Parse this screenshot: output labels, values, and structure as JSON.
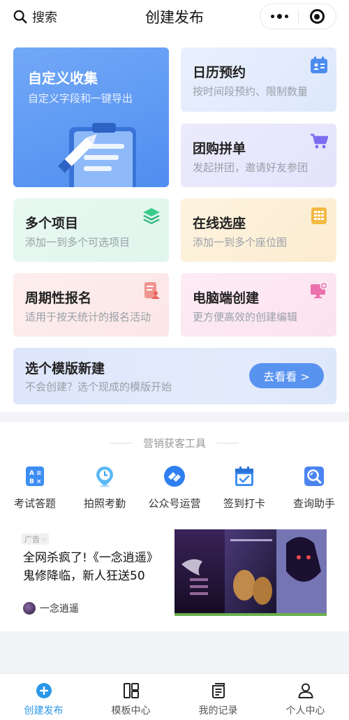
{
  "header": {
    "search_label": "搜索",
    "title": "创建发布"
  },
  "cards": {
    "custom": {
      "title": "自定义收集",
      "subtitle": "自定义字段和一键导出"
    },
    "calendar": {
      "title": "日历预约",
      "subtitle": "按时间段预约、限制数量"
    },
    "group": {
      "title": "团购拼单",
      "subtitle": "发起拼团，邀请好友参团"
    },
    "multi": {
      "title": "多个项目",
      "subtitle": "添加一到多个可选项目"
    },
    "seat": {
      "title": "在线选座",
      "subtitle": "添加一到多个座位图"
    },
    "period": {
      "title": "周期性报名",
      "subtitle": "适用于按天统计的报名活动"
    },
    "pc": {
      "title": "电脑端创建",
      "subtitle": "更方便高效的创建编辑"
    },
    "template": {
      "title": "选个模版新建",
      "subtitle": "不会创建？选个现成的模版开始",
      "button": "去看看 >"
    }
  },
  "marketing": {
    "section_title": "营销获客工具",
    "tools": [
      {
        "label": "考试答题",
        "icon": "exam-icon"
      },
      {
        "label": "拍照考勤",
        "icon": "location-clock-icon"
      },
      {
        "label": "公众号运营",
        "icon": "official-account-icon"
      },
      {
        "label": "签到打卡",
        "icon": "checkin-calendar-icon"
      },
      {
        "label": "查询助手",
        "icon": "search-assistant-icon"
      }
    ]
  },
  "ad": {
    "tag": "广告",
    "text": "全网杀疯了!《一念逍遥》鬼修降临，新人狂送50",
    "author": "一念逍遥"
  },
  "tabbar": {
    "items": [
      {
        "label": "创建发布",
        "icon": "plus-circle-icon",
        "active": true
      },
      {
        "label": "模板中心",
        "icon": "template-icon",
        "active": false
      },
      {
        "label": "我的记录",
        "icon": "records-icon",
        "active": false
      },
      {
        "label": "个人中心",
        "icon": "user-icon",
        "active": false
      }
    ]
  },
  "colors": {
    "primary": "#4f8ef0",
    "tab_active": "#2a97e8"
  }
}
